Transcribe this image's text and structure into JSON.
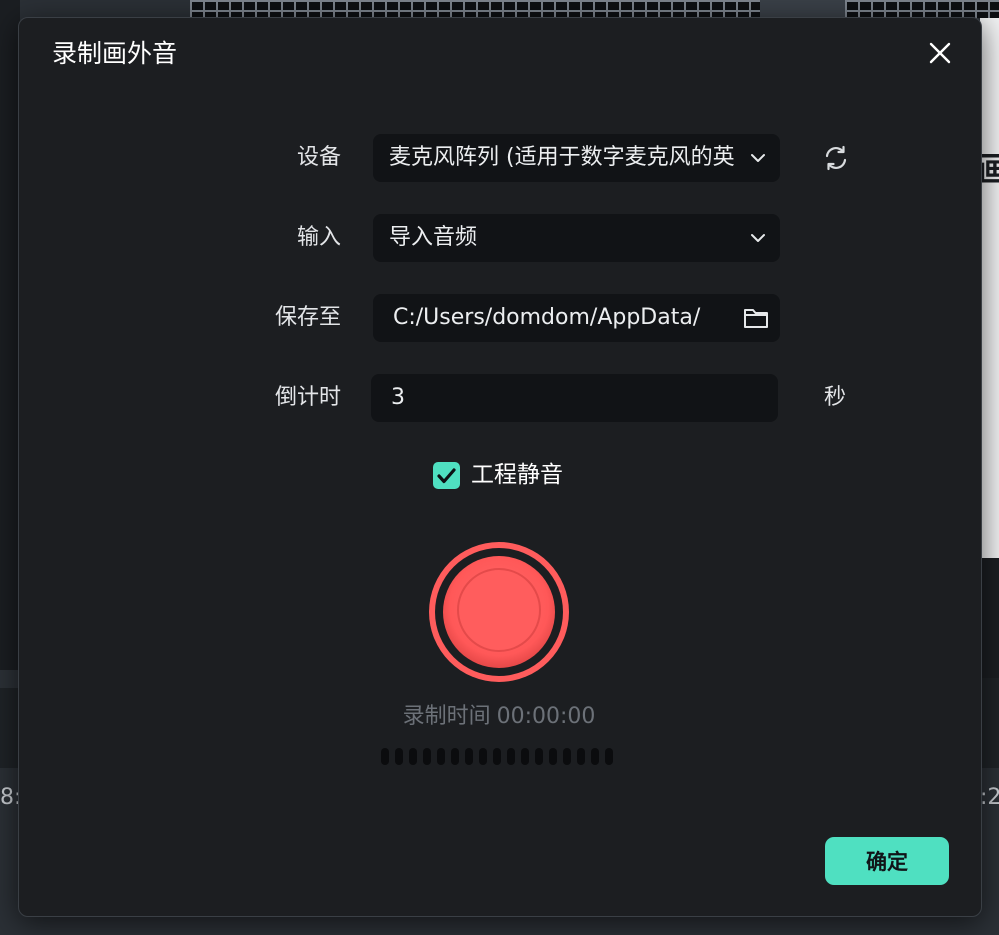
{
  "background": {
    "right_fragment": "画",
    "ruler_left": "8:",
    "ruler_right": ":2"
  },
  "dialog": {
    "title": "录制画外音",
    "close_icon": "close-icon",
    "device": {
      "label": "设备",
      "value": "麦克风阵列 (适用于数字麦克风的英"
    },
    "input": {
      "label": "输入",
      "value": "导入音频"
    },
    "save_to": {
      "label": "保存至",
      "value": "C:/Users/domdom/AppData/"
    },
    "countdown": {
      "label": "倒计时",
      "value": "3",
      "unit": "秒"
    },
    "mute_project": {
      "label": "工程静音",
      "checked": true
    },
    "record_time": {
      "label": "录制时间",
      "value": "00:00:00"
    },
    "confirm_label": "确定"
  },
  "colors": {
    "accent": "#4fe0c1",
    "record": "#ff5a5a",
    "dialog_bg": "#1c1e21"
  }
}
